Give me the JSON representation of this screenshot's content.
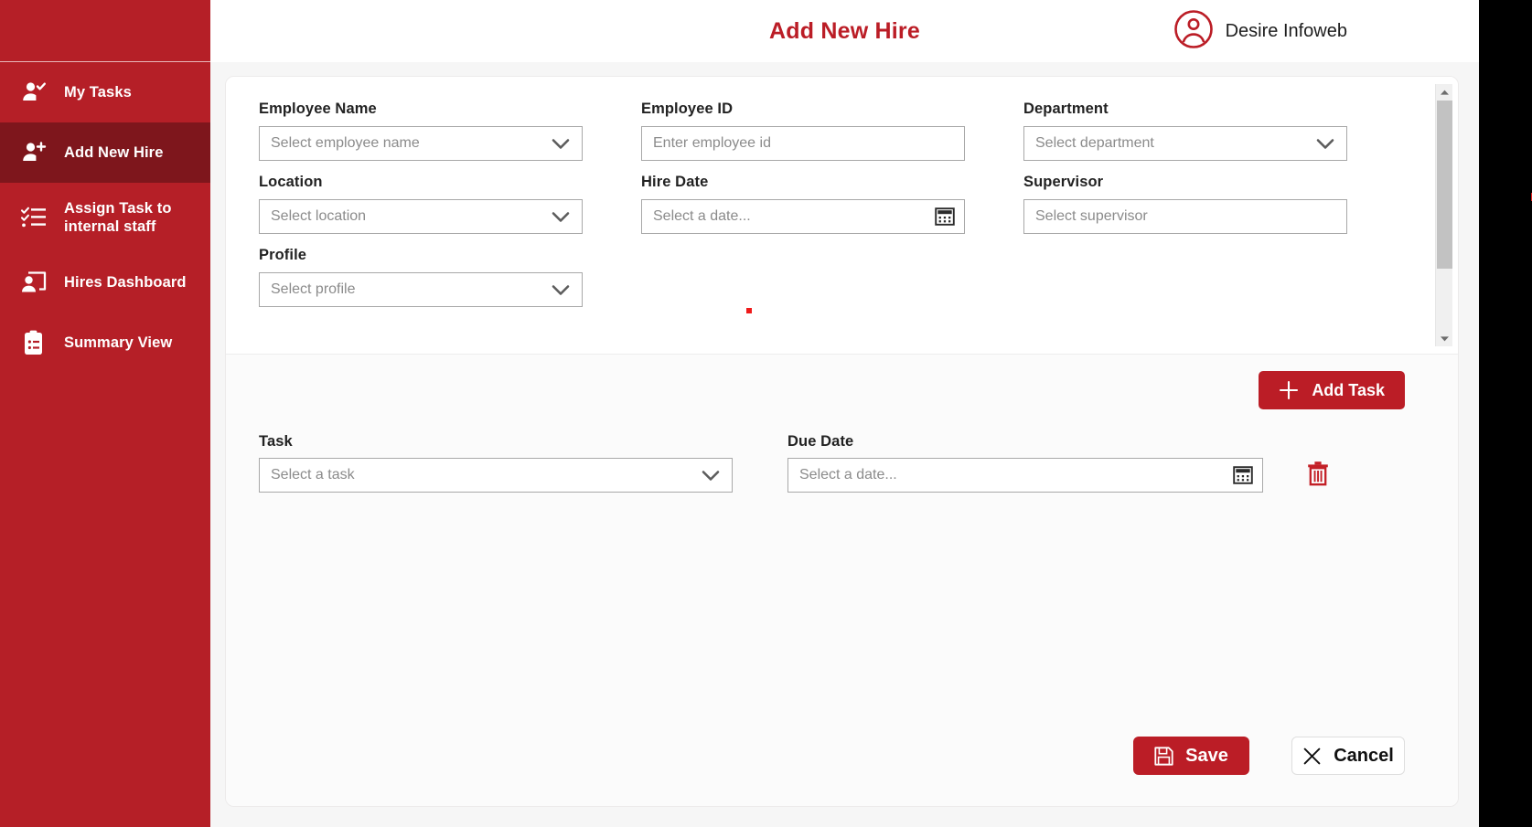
{
  "app": {
    "header": {
      "title": "Add New Hire",
      "user_name": "Desire Infoweb",
      "user_icon": "account-circle-icon",
      "title_color": "#bb1d26"
    },
    "sidebar": {
      "background_color": "#b51f27",
      "active_color": "#7e161c",
      "items": [
        {
          "label": "My Tasks",
          "icon": "user-check-icon",
          "active": false
        },
        {
          "label": "Add New Hire",
          "icon": "user-plus-icon",
          "active": true
        },
        {
          "label": "Assign Task to internal staff",
          "icon": "task-list-icon",
          "active": false
        },
        {
          "label": "Hires Dashboard",
          "icon": "user-screen-icon",
          "active": false
        },
        {
          "label": "Summary View",
          "icon": "clipboard-list-icon",
          "active": false
        }
      ]
    }
  },
  "form": {
    "fields": [
      {
        "label": "Employee Name",
        "placeholder": "Select employee name",
        "value": "",
        "control": "dropdown"
      },
      {
        "label": "Employee ID",
        "placeholder": "Enter employee id",
        "value": "",
        "control": "text"
      },
      {
        "label": "Department",
        "placeholder": "Select department",
        "value": "",
        "control": "dropdown"
      },
      {
        "label": "Location",
        "placeholder": "Select location",
        "value": "",
        "control": "dropdown"
      },
      {
        "label": "Hire Date",
        "placeholder": "Select a date...",
        "value": "",
        "control": "date"
      },
      {
        "label": "Supervisor",
        "placeholder": "Select supervisor",
        "value": "",
        "control": "text"
      },
      {
        "label": "Profile",
        "placeholder": "Select profile",
        "value": "",
        "control": "dropdown"
      }
    ],
    "scrollbar": {
      "up_icon": "scroll-up-arrow",
      "down_icon": "scroll-down-arrow"
    }
  },
  "tasks": {
    "add_task_label": "Add Task",
    "add_task_icon": "plus-icon",
    "delete_icon": "trash-icon",
    "columns": {
      "task_label": "Task",
      "due_date_label": "Due Date"
    },
    "rows": [
      {
        "task_placeholder": "Select a task",
        "task_value": "",
        "due_date_placeholder": "Select a date...",
        "due_date_value": ""
      }
    ]
  },
  "footer": {
    "save_label": "Save",
    "save_icon": "floppy-save-icon",
    "cancel_label": "Cancel",
    "cancel_icon": "close-x-icon"
  }
}
